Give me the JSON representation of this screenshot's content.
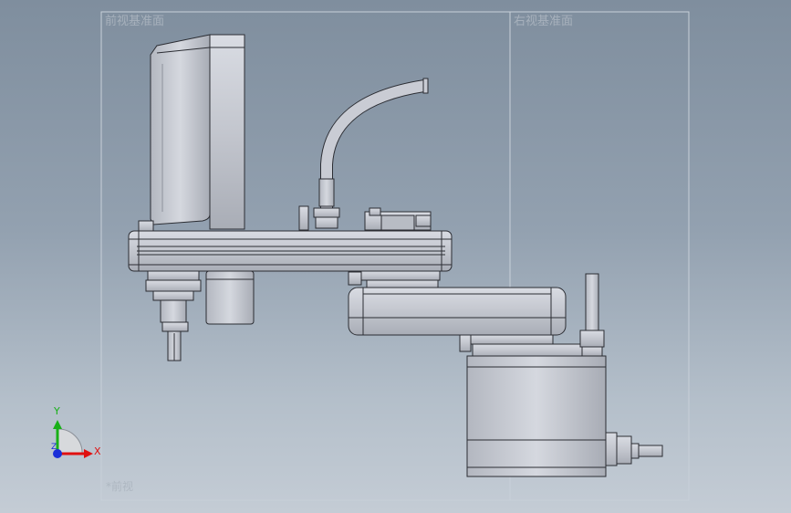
{
  "viewport": {
    "plane_left_label": "前视基准面",
    "plane_right_label": "右视基准面",
    "bottom_label": "*前视",
    "background_top": "#7f8e9e",
    "background_bottom": "#c4ccd5"
  },
  "triad": {
    "x_label": "X",
    "y_label": "Y",
    "z_label": "Z",
    "x_color": "#e01010",
    "y_color": "#18b018",
    "z_color": "#1a2fd8"
  },
  "model": {
    "body_color": "#c9ccd4",
    "outline_color": "#2b2d33",
    "icon": "scara-robot-icon"
  }
}
